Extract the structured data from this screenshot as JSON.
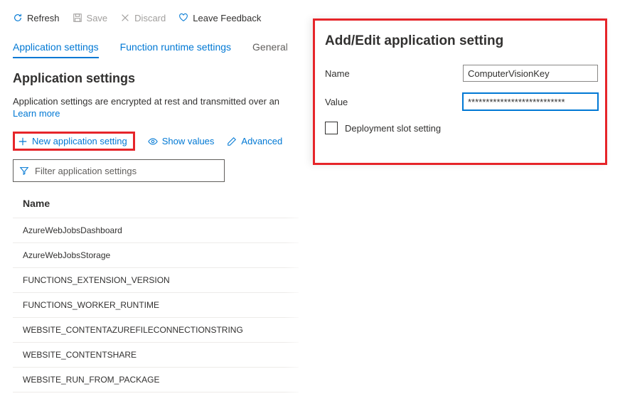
{
  "toolbar": {
    "refresh": "Refresh",
    "save": "Save",
    "discard": "Discard",
    "feedback": "Leave Feedback"
  },
  "tabs": {
    "app": "Application settings",
    "runtime": "Function runtime settings",
    "general": "General"
  },
  "section": {
    "title": "Application settings",
    "desc": "Application settings are encrypted at rest and transmitted over an",
    "learn_more": "Learn more"
  },
  "actions": {
    "new": "New application setting",
    "show_values": "Show values",
    "advanced": "Advanced"
  },
  "filter": {
    "placeholder": "Filter application settings"
  },
  "table": {
    "header": "Name",
    "rows": [
      "AzureWebJobsDashboard",
      "AzureWebJobsStorage",
      "FUNCTIONS_EXTENSION_VERSION",
      "FUNCTIONS_WORKER_RUNTIME",
      "WEBSITE_CONTENTAZUREFILECONNECTIONSTRING",
      "WEBSITE_CONTENTSHARE",
      "WEBSITE_RUN_FROM_PACKAGE"
    ]
  },
  "panel": {
    "title": "Add/Edit application setting",
    "name_label": "Name",
    "name_value": "ComputerVisionKey",
    "value_label": "Value",
    "value_value": "***************************",
    "slot_label": "Deployment slot setting"
  },
  "colors": {
    "accent": "#0078d4",
    "highlight": "#e6252a"
  }
}
